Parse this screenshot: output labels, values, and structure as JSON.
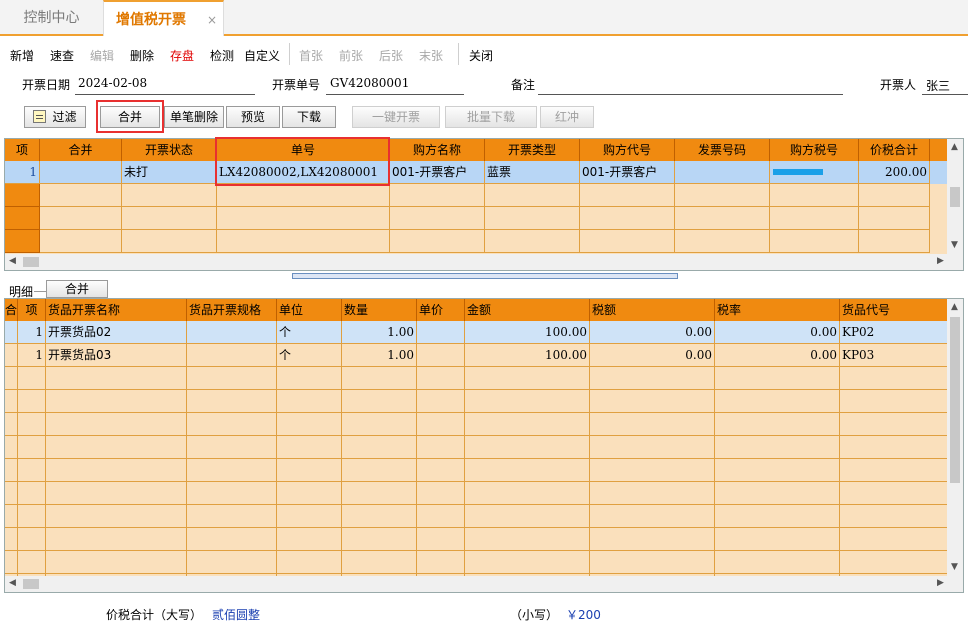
{
  "tabs": [
    {
      "label": "控制中心"
    },
    {
      "label": "增值税开票",
      "close": "×"
    }
  ],
  "toolbar": {
    "new": "新增",
    "quick": "速查",
    "edit": "编辑",
    "delete": "删除",
    "save": "存盘",
    "check": "检测",
    "custom": "自定义",
    "first": "首张",
    "prev": "前张",
    "next": "后张",
    "last": "末张",
    "close": "关闭"
  },
  "form": {
    "date_label": "开票日期",
    "date_value": "2024-02-08",
    "no_label": "开票单号",
    "no_value": "GV42080001",
    "remark_label": "备注",
    "remark_value": "",
    "issuer_label": "开票人",
    "issuer_value": "张三"
  },
  "buttons": {
    "filter": "过滤",
    "merge": "合并",
    "single_delete": "单笔删除",
    "preview": "预览",
    "download": "下载",
    "one_click": "一键开票",
    "batch_download": "批量下载",
    "red": "红冲"
  },
  "top_grid": {
    "columns": [
      "项",
      "合并",
      "开票状态",
      "单号",
      "购方名称",
      "开票类型",
      "购方代号",
      "发票号码",
      "购方税号",
      "价税合计"
    ],
    "rows": [
      {
        "idx": "1",
        "merge": "",
        "status": "未打",
        "no": "LX42080002,LX42080001",
        "buyer": "001-开票客户",
        "type": "蓝票",
        "buyer_code": "001-开票客户",
        "invoice_no": "",
        "tax_no": "",
        "total": "200.00"
      }
    ]
  },
  "detail": {
    "label": "明细",
    "merge_button": "合并",
    "columns": [
      "合",
      "项",
      "货品开票名称",
      "货品开票规格",
      "单位",
      "数量",
      "单价",
      "金额",
      "税额",
      "税率",
      "货品代号"
    ],
    "rows": [
      {
        "idx": "1",
        "name": "开票货品02",
        "spec": "",
        "unit": "个",
        "qty": "1.00",
        "price": "",
        "amount": "100.00",
        "tax": "0.00",
        "rate": "0.00",
        "code": "KP02"
      },
      {
        "idx": "1",
        "name": "开票货品03",
        "spec": "",
        "unit": "个",
        "qty": "1.00",
        "price": "",
        "amount": "100.00",
        "tax": "0.00",
        "rate": "0.00",
        "code": "KP03"
      }
    ]
  },
  "footer": {
    "total_label": "价税合计（大写）",
    "total_upper": "贰佰圆整",
    "small_label": "（小写）",
    "total_small": "￥200"
  },
  "colors": {
    "header": "#f08a10",
    "row_fill": "#fae0bc",
    "selected": "#b8d6f5",
    "accent": "#e07800",
    "highlight_box": "#e83030"
  }
}
